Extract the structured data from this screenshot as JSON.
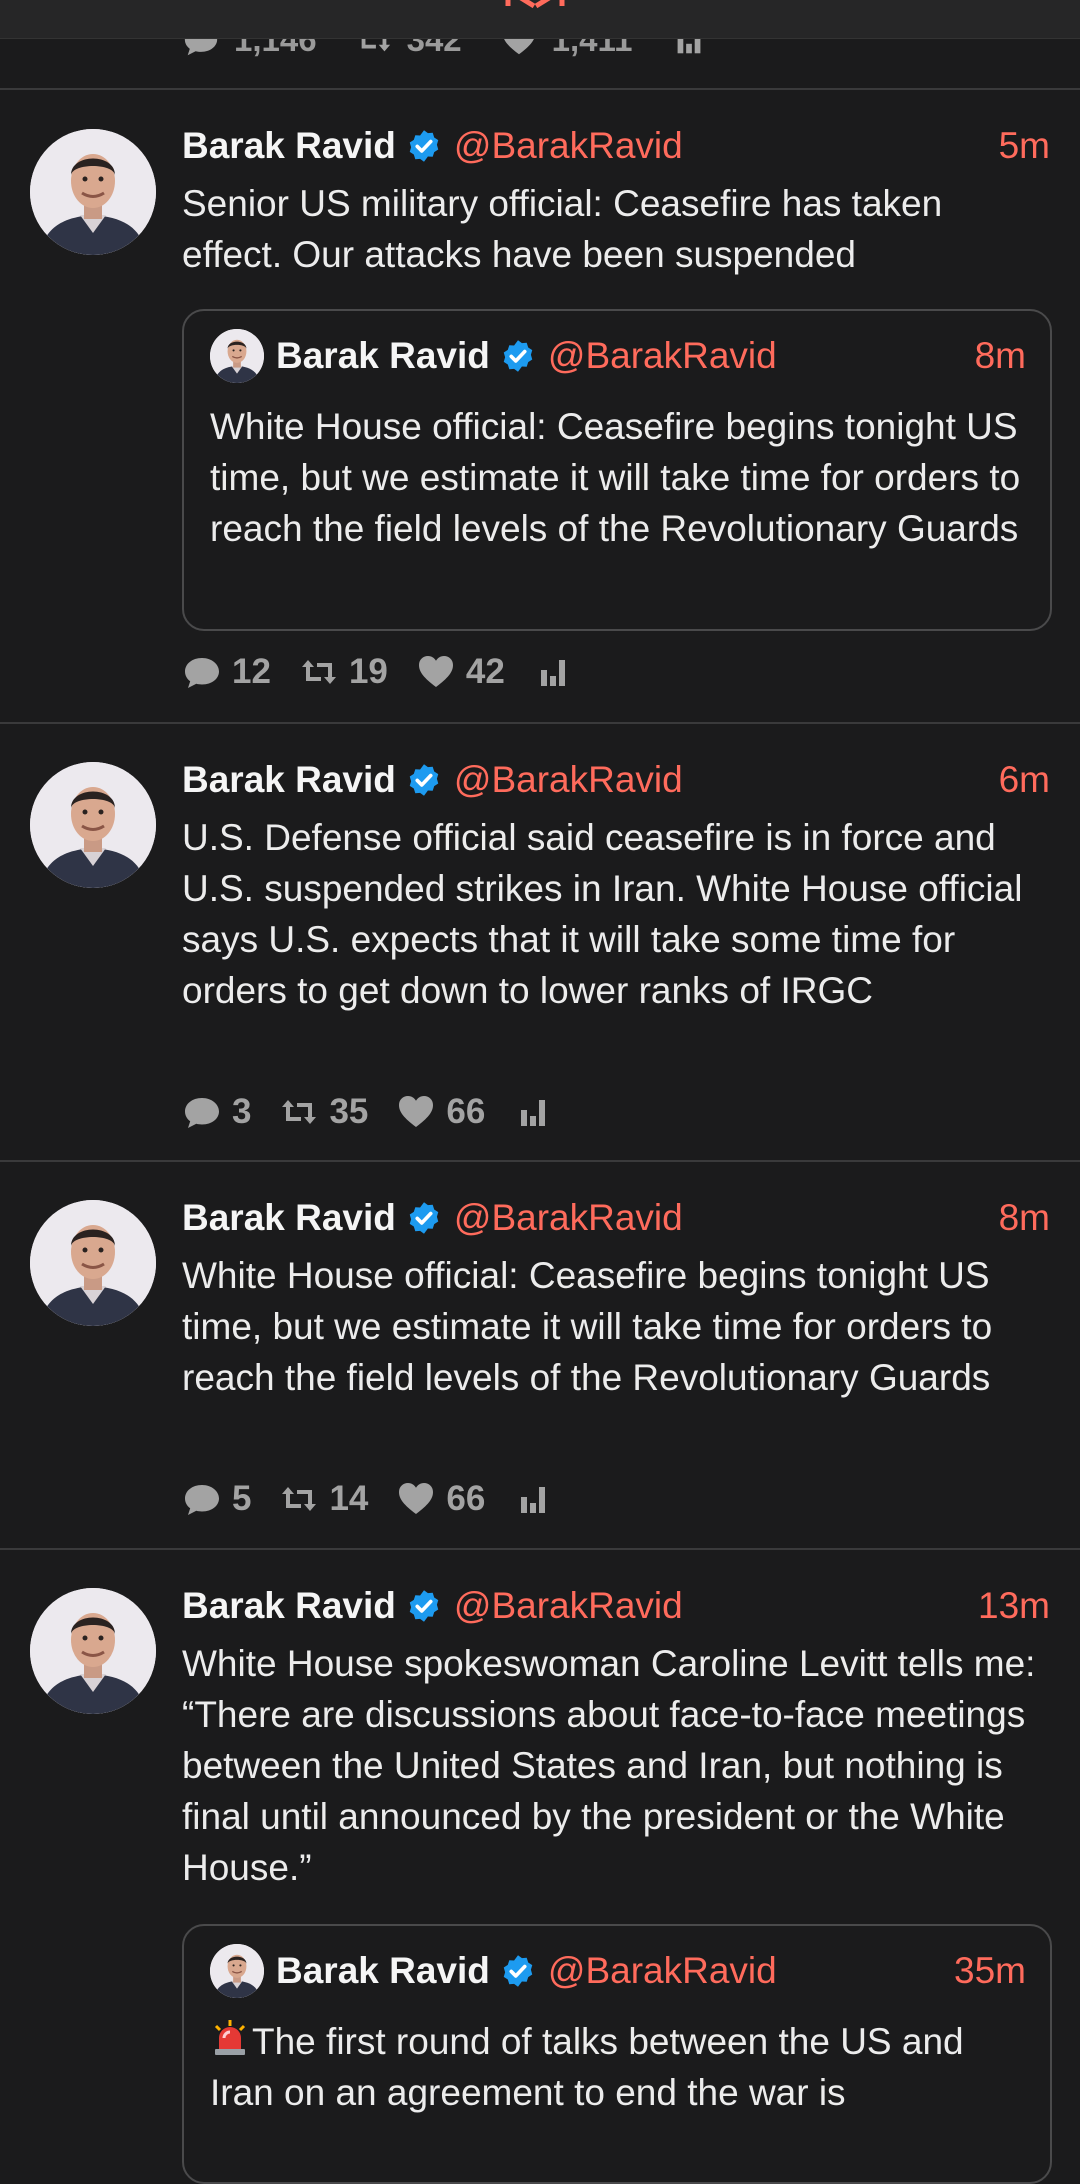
{
  "top": {
    "prev_actions": {
      "replies": "1,146",
      "retweets": "342",
      "likes": "1,411"
    }
  },
  "colors": {
    "accent": "#ff6b5c",
    "verified": "#1d9bf0",
    "background": "#1b1b1c"
  },
  "tweets": [
    {
      "name": "Barak Ravid",
      "handle": "@BarakRavid",
      "time": "5m",
      "text": "Senior US military official: Ceasefire has taken effect. Our attacks have been suspended",
      "quote": {
        "name": "Barak Ravid",
        "handle": "@BarakRavid",
        "time": "8m",
        "text": "White House official: Ceasefire begins tonight US time, but we estimate it will take time for orders to reach the field levels of the Revolutionary Guards"
      },
      "replies": "12",
      "retweets": "19",
      "likes": "42"
    },
    {
      "name": "Barak Ravid",
      "handle": "@BarakRavid",
      "time": "6m",
      "text": "U.S. Defense official said ceasefire is in force and U.S. suspended strikes in Iran. White House official says U.S. expects that it will take some time for orders to get down to lower ranks of IRGC",
      "replies": "3",
      "retweets": "35",
      "likes": "66"
    },
    {
      "name": "Barak Ravid",
      "handle": "@BarakRavid",
      "time": "8m",
      "text": "White House official: Ceasefire begins tonight US time, but we estimate it will take time for orders to reach the field levels of the Revolutionary Guards",
      "replies": "5",
      "retweets": "14",
      "likes": "66"
    },
    {
      "name": "Barak Ravid",
      "handle": "@BarakRavid",
      "time": "13m",
      "text": "White House spokeswoman Caroline Levitt tells me: “There are discussions about face-to-face meetings between the United States and Iran, but nothing is final until announced by the president or the White House.”",
      "quote": {
        "name": "Barak Ravid",
        "handle": "@BarakRavid",
        "time": "35m",
        "icon": "siren-icon",
        "text": "The first round of talks between the US and Iran on an agreement to end the war is"
      }
    }
  ]
}
